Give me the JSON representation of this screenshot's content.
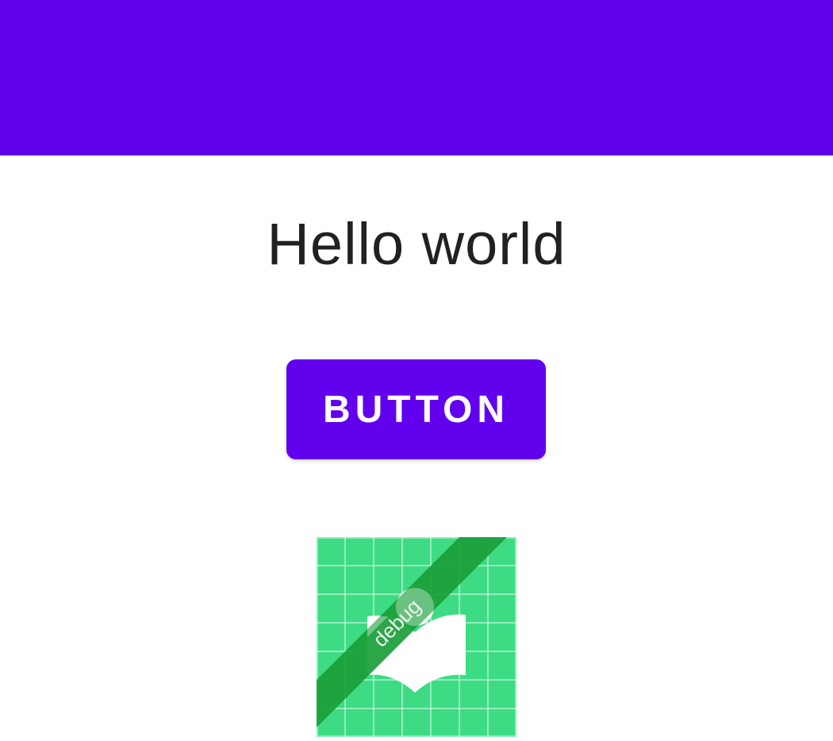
{
  "app_bar": {
    "color": "#6200ee"
  },
  "main": {
    "greeting": "Hello world",
    "button_label": "BUTTON",
    "button_color": "#6200ee"
  },
  "launcher_icon": {
    "icon": "book-icon",
    "badge_text": "debug",
    "background_color": "#3ddc84",
    "ribbon_color": "#1a9e3a"
  }
}
